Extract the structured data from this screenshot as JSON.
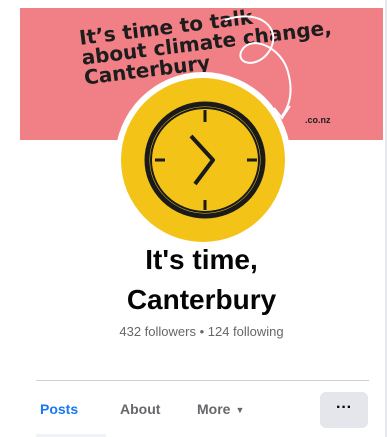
{
  "cover": {
    "headline": [
      "It’s time to talk",
      "about climate change,",
      "Canterbury"
    ],
    "url_suffix": ".co.nz",
    "background_color": "#f07f86"
  },
  "avatar": {
    "background_color": "#f3c318",
    "icon": "clock-icon"
  },
  "profile": {
    "name_line1": "It's time,",
    "name_line2": "Canterbury",
    "stats": "432 followers • 124 following"
  },
  "tabs": [
    {
      "label": "Posts",
      "active": true
    },
    {
      "label": "About",
      "active": false
    },
    {
      "label": "More",
      "active": false,
      "icon": "caret-down-icon"
    }
  ],
  "actions": {
    "more_button_label": "···"
  },
  "colors": {
    "accent": "#1877f2",
    "secondary_text": "#65676b"
  }
}
